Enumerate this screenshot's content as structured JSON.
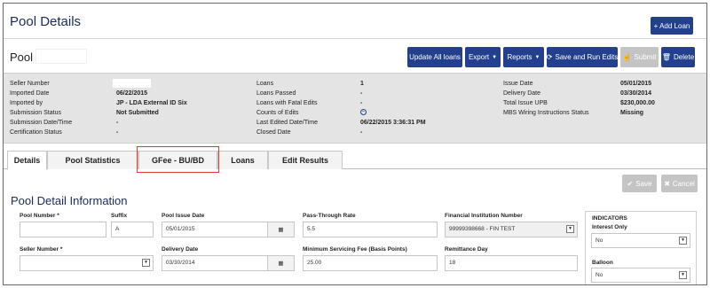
{
  "header": {
    "title": "Pool Details",
    "add_loan_label": "+ Add Loan"
  },
  "pool_row": {
    "label": "Pool :",
    "pool_value": "",
    "buttons": {
      "update_all_loans": "Update All loans",
      "export": "Export",
      "reports": "Reports",
      "save_and_run_edits": "Save and Run Edits",
      "submit": "Submit",
      "delete": "Delete"
    }
  },
  "summary": {
    "col1": [
      {
        "label": "Seller Number",
        "value": ""
      },
      {
        "label": "Imported Date",
        "value": "06/22/2015"
      },
      {
        "label": "Imported by",
        "value": "JP - LDA External ID Six"
      },
      {
        "label": "Submission Status",
        "value": "Not Submitted"
      },
      {
        "label": "Submission Date/Time",
        "value": "-"
      },
      {
        "label": "Certification Status",
        "value": "-"
      }
    ],
    "col2": [
      {
        "label": "Loans",
        "value": "1"
      },
      {
        "label": "Loans Passed",
        "value": "-"
      },
      {
        "label": "Loans with Fatal Edits",
        "value": "-"
      },
      {
        "label": "Counts of Edits",
        "value": ""
      },
      {
        "label": "Last Edited Date/Time",
        "value": "06/22/2015 3:36:31 PM"
      },
      {
        "label": "Closed Date",
        "value": "-"
      }
    ],
    "col3": [
      {
        "label": "Issue Date",
        "value": "05/01/2015"
      },
      {
        "label": "Delivery Date",
        "value": "03/30/2014"
      },
      {
        "label": "Total Issue UPB",
        "value": "$230,000.00"
      },
      {
        "label": "MBS Wiring Instructions Status",
        "value": "Missing"
      }
    ]
  },
  "tabs": [
    "Details",
    "Pool Statistics",
    "GFee - BU/BD",
    "Loans",
    "Edit Results"
  ],
  "form": {
    "section_title": "Pool Detail Information",
    "save_label": "Save",
    "cancel_label": "Cancel",
    "pool_number": {
      "label": "Pool Number *",
      "value": ""
    },
    "suffix": {
      "label": "Suffix",
      "value": "A"
    },
    "pool_issue_date": {
      "label": "Pool Issue Date",
      "value": "05/01/2015"
    },
    "pass_through_rate": {
      "label": "Pass-Through Rate",
      "value": "5.5"
    },
    "fin_inst_number": {
      "label": "Financial Institution Number",
      "value": "99999398668 - FIN TEST"
    },
    "seller_number": {
      "label": "Seller Number *",
      "value": ""
    },
    "delivery_date": {
      "label": "Delivery Date",
      "value": "03/30/2014"
    },
    "min_servicing_fee": {
      "label": "Minimum Servicing Fee (Basis Points)",
      "value": "25.00"
    },
    "remittance_day": {
      "label": "Remittance Day",
      "value": "18"
    },
    "indicators": {
      "title": "INDICATORS",
      "interest_only_label": "Interest Only",
      "interest_only_value": "No",
      "balloon_label": "Balloon",
      "balloon_value": "No"
    }
  },
  "colors": {
    "primary": "#23408e",
    "highlight": "#e23a3a",
    "summary_bg": "#e4e4e4"
  }
}
